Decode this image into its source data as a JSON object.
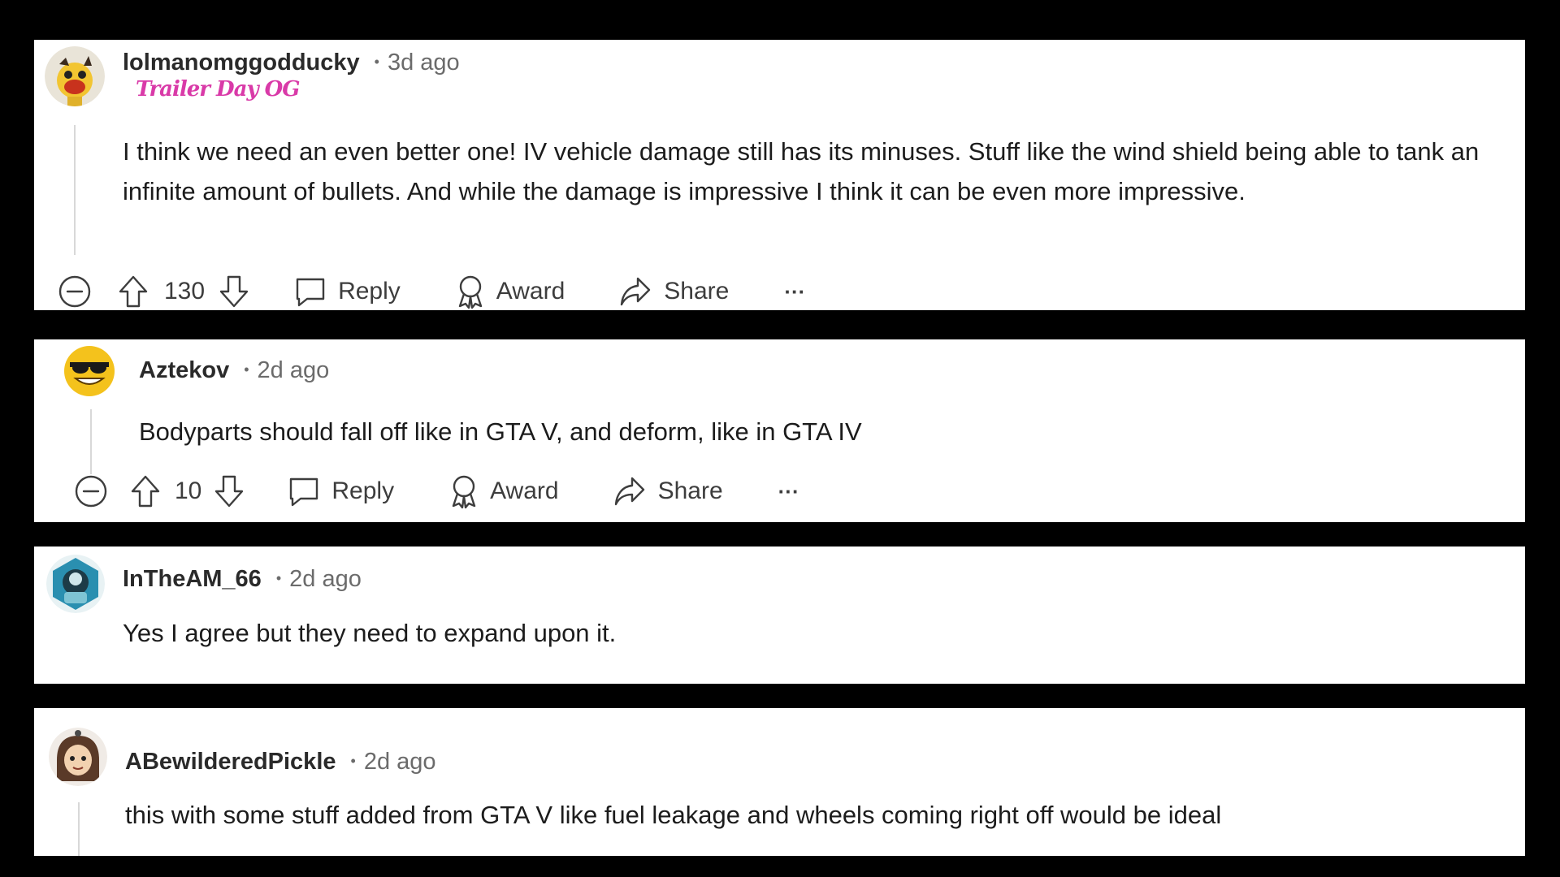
{
  "comments": [
    {
      "username": "lolmanomggodducky",
      "dot": "•",
      "time": "3d ago",
      "flair": "Trailer Day OG",
      "body": "I think we need an even better one! IV vehicle damage still has its minuses. Stuff like the wind shield being able to tank an infinite amount of bullets. And while the damage is impressive I think it can be even more impressive.",
      "votes": "130",
      "reply": "Reply",
      "award": "Award",
      "share": "Share",
      "more": "···"
    },
    {
      "username": "Aztekov",
      "dot": "•",
      "time": "2d ago",
      "body": "Bodyparts should fall off like in GTA V, and deform, like in GTA IV",
      "votes": "10",
      "reply": "Reply",
      "award": "Award",
      "share": "Share",
      "more": "···"
    },
    {
      "username": "InTheAM_66",
      "dot": "•",
      "time": "2d ago",
      "body": "Yes I agree but they need to expand upon it."
    },
    {
      "username": "ABewilderedPickle",
      "dot": "•",
      "time": "2d ago",
      "body": "this with some stuff added from GTA V like fuel leakage and wheels coming right off would be ideal"
    }
  ],
  "icons": {
    "collapse": "minus-circle-icon",
    "upvote": "arrow-up-icon",
    "downvote": "arrow-down-icon",
    "reply": "speech-bubble-icon",
    "award": "award-ribbon-icon",
    "share": "share-arrow-icon"
  },
  "colors": {
    "flair": "#d93aa8",
    "background": "#000000",
    "card": "#ffffff"
  }
}
